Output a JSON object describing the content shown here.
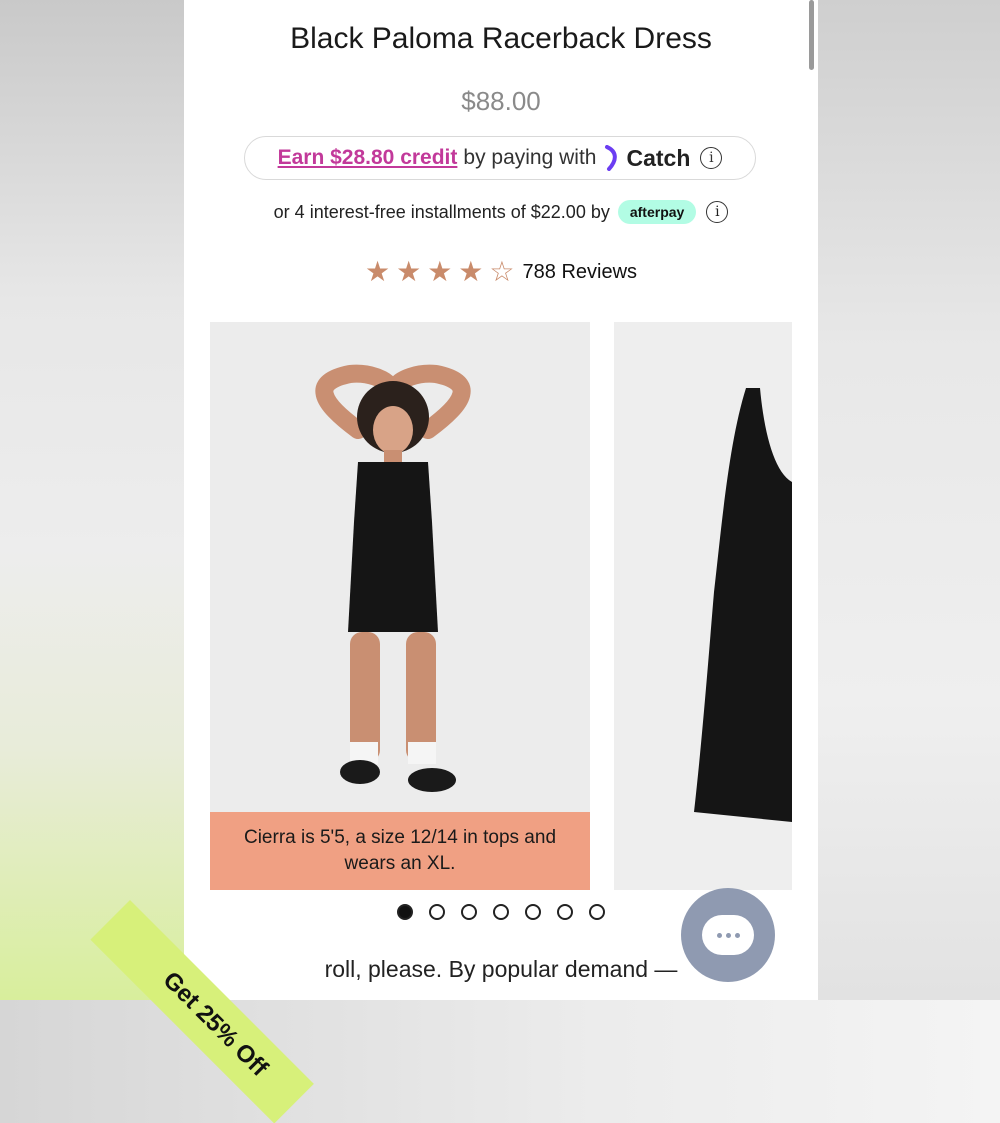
{
  "product": {
    "title": "Black Paloma Racerback Dress",
    "price": "$88.00"
  },
  "catch_offer": {
    "earn_text": "Earn $28.80 credit",
    "middle_text": "by paying with",
    "brand": "Catch",
    "info_icon": "i"
  },
  "afterpay": {
    "text": "or 4 interest-free installments of $22.00 by",
    "badge": "afterpay",
    "info_icon": "i"
  },
  "rating": {
    "stars_filled": 4,
    "stars_total": 5,
    "reviews_label": "788 Reviews"
  },
  "gallery": {
    "caption": "Cierra is 5'5, a size 12/14 in tops and wears an XL.",
    "slides_count": 7,
    "active_index": 0
  },
  "description_snippet": "roll, please. By popular demand —",
  "promo_tab": "Get 25% Off",
  "colors": {
    "accent_pink": "#c2399a",
    "star": "#c98b6b",
    "caption_bg": "#f0a083",
    "afterpay_bg": "#b2fce4",
    "promo_bg": "#d7f07a",
    "chat_bg": "#8f9ab1"
  }
}
